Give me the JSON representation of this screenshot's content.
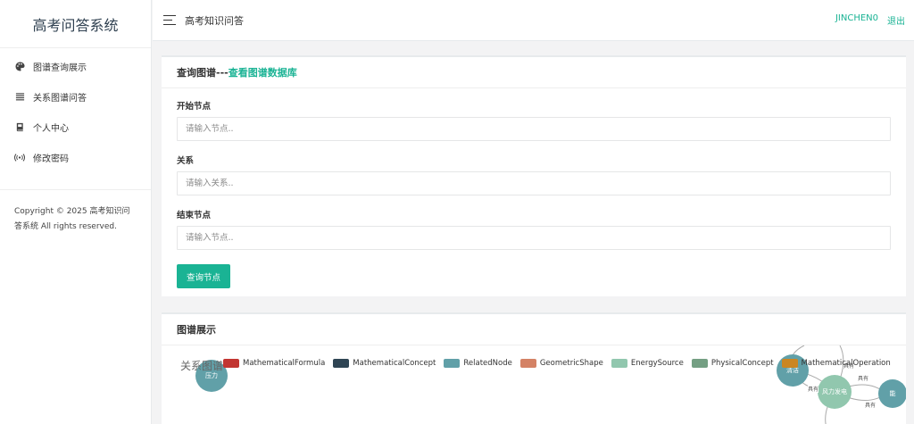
{
  "sidebar": {
    "brand": "高考问答系统",
    "items": [
      {
        "label": "图谱查询展示",
        "icon": "palette-icon"
      },
      {
        "label": "关系图谱问答",
        "icon": "list-icon"
      },
      {
        "label": "个人中心",
        "icon": "book-icon"
      },
      {
        "label": "修改密码",
        "icon": "broadcast-icon"
      }
    ],
    "copyright": "Copyright © 2025 高考知识问答系统 All rights reserved."
  },
  "topbar": {
    "title": "高考知识问答",
    "username": "JINCHEN0",
    "logout": "退出"
  },
  "query_card": {
    "title_prefix": "查询图谱---",
    "title_link": "查看图谱数据库",
    "start_label": "开始节点",
    "start_placeholder": "请输入节点..",
    "relation_label": "关系",
    "relation_placeholder": "请输入关系..",
    "end_label": "结束节点",
    "end_placeholder": "请输入节点..",
    "submit": "查询节点"
  },
  "graph_card": {
    "title": "图谱展示",
    "chart_title": "关系图谱",
    "legend": [
      {
        "name": "MathematicalFormula",
        "color": "#c23531"
      },
      {
        "name": "MathematicalConcept",
        "color": "#2f4554"
      },
      {
        "name": "RelatedNode",
        "color": "#61a0a8"
      },
      {
        "name": "GeometricShape",
        "color": "#d48265"
      },
      {
        "name": "EnergySource",
        "color": "#91c7ae"
      },
      {
        "name": "PhysicalConcept",
        "color": "#749f83"
      },
      {
        "name": "MathematicalOperation",
        "color": "#ca8622"
      }
    ],
    "nodes": [
      {
        "label": "压力",
        "color": "#61a0a8"
      },
      {
        "label": "清洁",
        "color": "#61a0a8"
      },
      {
        "label": "风力发电",
        "color": "#91c7ae"
      },
      {
        "label": "能",
        "color": "#61a0a8"
      }
    ],
    "edge_label": "具有"
  }
}
